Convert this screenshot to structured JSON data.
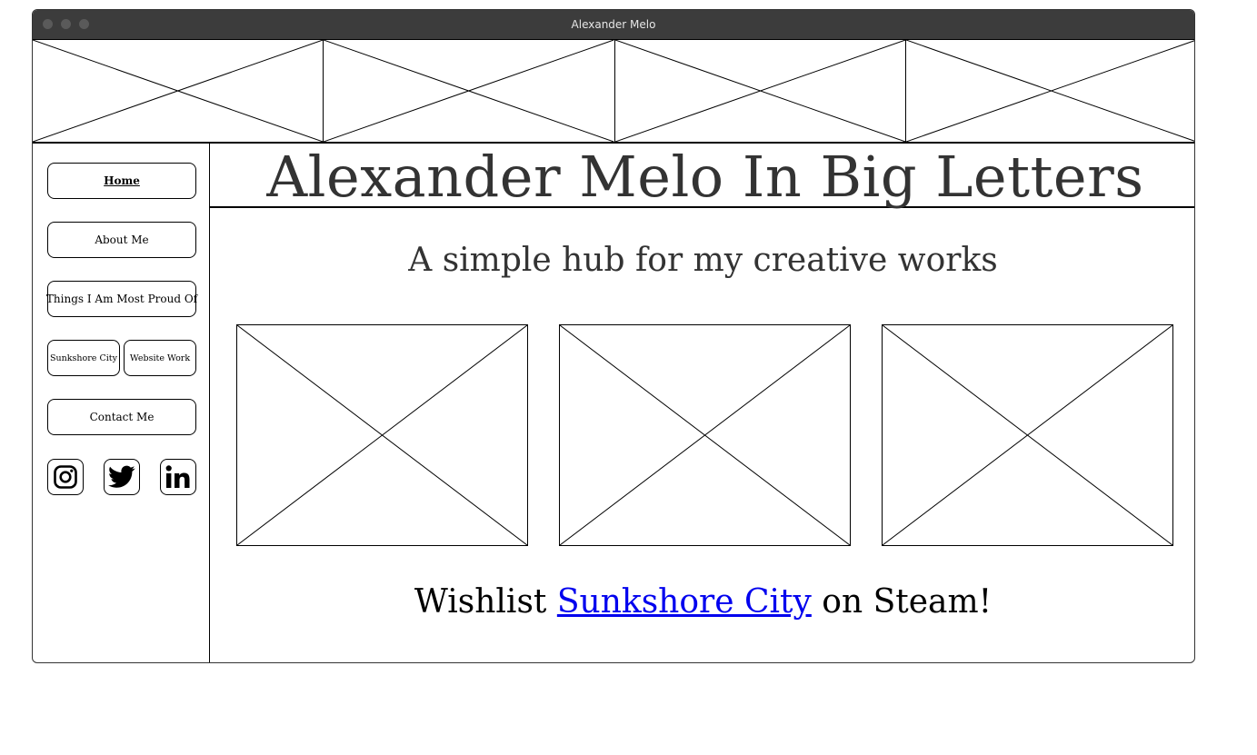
{
  "window": {
    "title": "Alexander Melo"
  },
  "sidebar": {
    "items": [
      {
        "label": "Home",
        "active": true
      },
      {
        "label": "About Me"
      },
      {
        "label": "Things I Am Most Proud Of"
      },
      {
        "label": "Sunkshore City"
      },
      {
        "label": "Website Work"
      },
      {
        "label": "Contact Me"
      }
    ],
    "social": [
      {
        "icon": "instagram-icon"
      },
      {
        "icon": "twitter-icon"
      },
      {
        "icon": "linkedin-icon"
      }
    ]
  },
  "main": {
    "headline": "Alexander Melo In Big Letters",
    "subtitle": "A simple hub for my creative works",
    "wishlist": {
      "prefix": "Wishlist ",
      "link": "Sunkshore City",
      "suffix": " on Steam!"
    }
  },
  "colors": {
    "titlebar": "#3c3c3c",
    "link": "#0000ee",
    "text": "#333333"
  }
}
